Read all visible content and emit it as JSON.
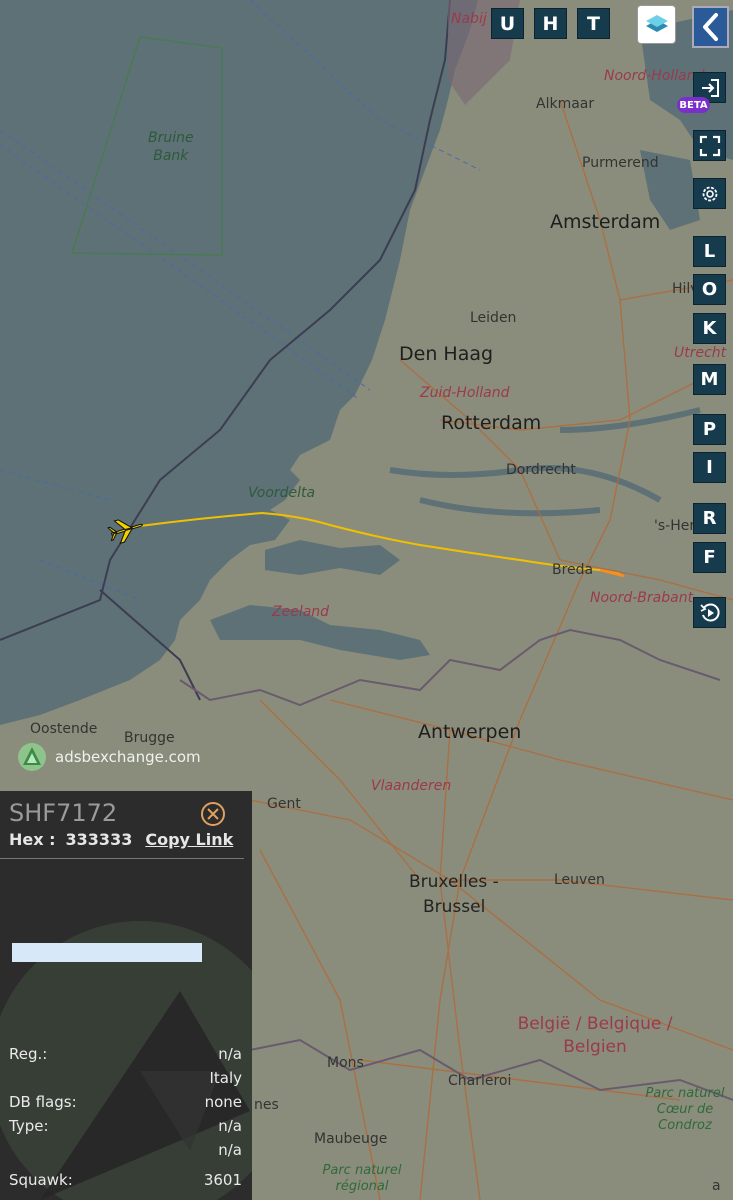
{
  "top_buttons": [
    "U",
    "H",
    "T"
  ],
  "side_buttons": [
    "L",
    "O",
    "K",
    "M",
    "P",
    "I",
    "R",
    "F"
  ],
  "icons": {
    "layers": "layers-icon",
    "collapse": "chevron-left-icon",
    "login": "login-icon",
    "fullscreen": "fullscreen-icon",
    "settings": "gear-icon",
    "replay": "replay-icon",
    "close": "close-icon"
  },
  "beta_label": "BETA",
  "attribution": "adsbexchange.com",
  "map_labels": {
    "nabij": "Nabij",
    "noord_holland": "Noord-Holland",
    "alkmaar": "Alkmaar",
    "purmerend": "Purmerend",
    "amsterdam": "Amsterdam",
    "hilversum": "Hilvers",
    "bruine_bank_1": "Bruine",
    "bruine_bank_2": "Bank",
    "leiden": "Leiden",
    "den_haag": "Den Haag",
    "utrecht": "Utrecht",
    "zuid_holland": "Zuid-Holland",
    "rotterdam": "Rotterdam",
    "dordrecht": "Dordrecht",
    "voordelta": "Voordelta",
    "s_hertogenbosch": "'s-Her",
    "breda": "Breda",
    "noord_brabant": "Noord-Brabant",
    "zeeland": "Zeeland",
    "oostende": "Oostende",
    "brugge": "Brugge",
    "antwerpen": "Antwerpen",
    "vlaanderen": "Vlaanderen",
    "gent": "Gent",
    "bruxelles": "Bruxelles -",
    "brussel": "Brussel",
    "leuven": "Leuven",
    "belgie_1": "België / Belgique /",
    "belgie_2": "Belgien",
    "mons": "Mons",
    "charleroi": "Charleroi",
    "maubeuge": "Maubeuge",
    "nes": "nes",
    "park_1": "Parc naturel",
    "park_2": "Cœur de",
    "park_3": "Condroz",
    "park_fr_1": "Parc naturel",
    "park_fr_2": "régional",
    "edge_a": "a"
  },
  "aircraft": {
    "callsign": "SHF7172",
    "hex_label": "Hex :",
    "hex_value": "333333",
    "copy_link": "Copy Link",
    "rows": [
      {
        "label": "Reg.:",
        "value": "n/a"
      },
      {
        "label": "",
        "value": "Italy"
      },
      {
        "label": "DB flags:",
        "value": "none"
      },
      {
        "label": "Type:",
        "value": "n/a"
      },
      {
        "label": "",
        "value": "n/a"
      },
      {
        "label": "Squawk:",
        "value": "3601"
      }
    ]
  },
  "colors": {
    "sea": "#5d7177",
    "land": "#8b8d7c",
    "track": "#f0c000",
    "track_end": "#ff8a1a",
    "button_bg": "#163b4d",
    "panel_bg": "#2c2c2c",
    "beta": "#7b2fc9"
  }
}
